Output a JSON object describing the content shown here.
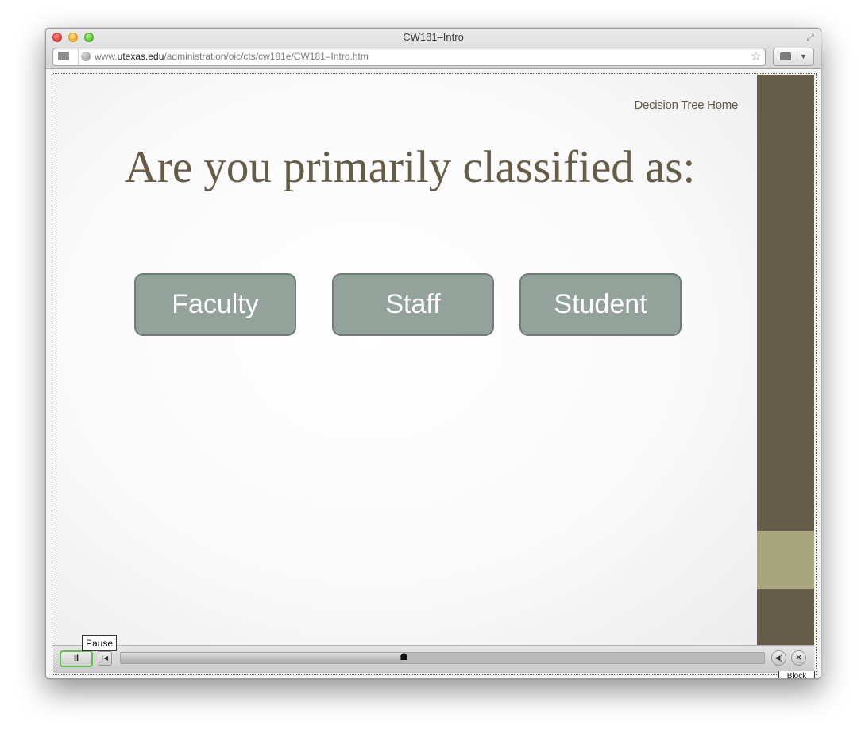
{
  "window": {
    "title": "CW181–Intro"
  },
  "addressbar": {
    "url_prefix": "www.",
    "url_domain": "utexas.edu",
    "url_path": "/administration/oic/cts/cw181e/CW181–Intro.htm"
  },
  "slide": {
    "home_link": "Decision Tree Home",
    "question": "Are you primarily classified as:",
    "choices": [
      "Faculty",
      "Staff",
      "Student"
    ]
  },
  "player": {
    "pause_label": "II",
    "rewind_label": "|◀",
    "volume_label": "◀)",
    "close_label": "✕",
    "tooltip": "Pause",
    "progress_fraction": 0.44
  },
  "plugin": {
    "block_label": "Block"
  },
  "colors": {
    "brand_brown": "#665d48",
    "sidebar_highlight": "#a8a67d",
    "choice_button": "#93a29a"
  },
  "icons": {
    "addressbar_left": "reader-icon",
    "site": "globe-icon",
    "bookmark": "star-icon",
    "extension": "extension-icon",
    "fullscreen": "fullscreen-icon"
  }
}
